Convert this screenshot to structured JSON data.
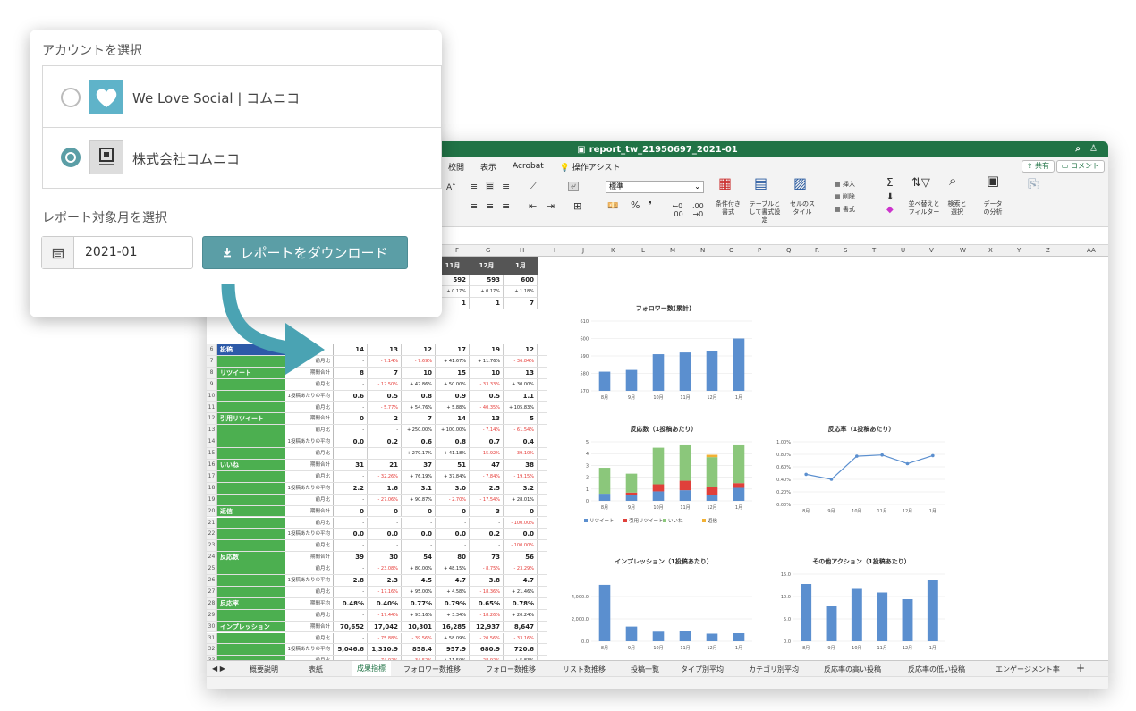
{
  "popup": {
    "account_heading": "アカウントを選択",
    "accounts": [
      {
        "name": "We Love Social | コムニコ",
        "selected": false
      },
      {
        "name": "株式会社コムニコ",
        "selected": true
      }
    ],
    "month_heading": "レポート対象月を選択",
    "month_value": "2021-01",
    "download_label": "レポートをダウンロード",
    "accent": "#5b9ea6"
  },
  "excel": {
    "title": "report_tw_21950697_2021-01",
    "menu": [
      "校閲",
      "表示",
      "Acrobat",
      "操作アシスト"
    ],
    "share": "共有",
    "comment": "コメント",
    "number_format": "標準",
    "ribbon": {
      "cond_format": "条件付き書式",
      "table_format": "テーブルとして書式設定",
      "cell_style": "セルのスタイル",
      "insert": "挿入",
      "delete": "削除",
      "format": "書式",
      "sort_filter": "並べ替えとフィルター",
      "find_select": "検索と選択",
      "data_analysis": "データの分析"
    },
    "columns": [
      "F",
      "G",
      "H",
      "I",
      "J",
      "K",
      "L",
      "M",
      "N",
      "O",
      "P",
      "Q",
      "R",
      "S",
      "T",
      "U",
      "V",
      "W",
      "X",
      "Y",
      "Z",
      "AA"
    ],
    "month_headers": [
      "11月",
      "12月",
      "1月"
    ],
    "sheet_tabs": [
      "概要説明",
      "表紙",
      "成果指標",
      "フォロワー数推移",
      "フォロー数推移",
      "リスト数推移",
      "投稿一覧",
      "タイプ別平均",
      "カテゴリ別平均",
      "反応率の高い投稿",
      "反応率の低い投稿",
      "エンゲージメント率"
    ],
    "active_tab": "成果指標",
    "top_rows": [
      {
        "vals": [
          "592",
          "593",
          "600"
        ]
      },
      {
        "vals": [
          "+ 0.17%",
          "+ 0.17%",
          "+ 1.18%"
        ]
      },
      {
        "vals": [
          "1",
          "1",
          "7"
        ]
      }
    ],
    "rows": [
      {
        "n": "6",
        "label": "投稿",
        "sub": "",
        "v": [
          "14",
          "13",
          "12",
          "17",
          "19",
          "12"
        ],
        "b": true
      },
      {
        "n": "7",
        "sub": "前月比",
        "v": [
          "-",
          "- 7.14%",
          "- 7.69%",
          "+ 41.67%",
          "+ 11.76%",
          "- 36.84%"
        ]
      },
      {
        "n": "8",
        "label": "リツイート",
        "sub": "期間合計",
        "v": [
          "8",
          "7",
          "10",
          "15",
          "10",
          "13"
        ],
        "b": true
      },
      {
        "n": "9",
        "sub": "前月比",
        "v": [
          "-",
          "- 12.50%",
          "+ 42.86%",
          "+ 50.00%",
          "- 33.33%",
          "+ 30.00%"
        ]
      },
      {
        "n": "10",
        "sub": "1投稿あたりの平均",
        "v": [
          "0.6",
          "0.5",
          "0.8",
          "0.9",
          "0.5",
          "1.1"
        ],
        "b": true
      },
      {
        "n": "11",
        "sub": "前月比",
        "v": [
          "-",
          "- 5.77%",
          "+ 54.76%",
          "+ 5.88%",
          "- 40.35%",
          "+ 105.83%"
        ]
      },
      {
        "n": "12",
        "label": "引用リツイート",
        "sub": "期間合計",
        "v": [
          "0",
          "2",
          "7",
          "14",
          "13",
          "5"
        ],
        "b": true
      },
      {
        "n": "13",
        "sub": "前月比",
        "v": [
          "-",
          "-",
          "+ 250.00%",
          "+ 100.00%",
          "- 7.14%",
          "- 61.54%"
        ]
      },
      {
        "n": "14",
        "sub": "1投稿あたりの平均",
        "v": [
          "0.0",
          "0.2",
          "0.6",
          "0.8",
          "0.7",
          "0.4"
        ],
        "b": true
      },
      {
        "n": "15",
        "sub": "前月比",
        "v": [
          "-",
          "-",
          "+ 279.17%",
          "+ 41.18%",
          "- 15.92%",
          "- 39.10%"
        ]
      },
      {
        "n": "16",
        "label": "いいね",
        "sub": "期間合計",
        "v": [
          "31",
          "21",
          "37",
          "51",
          "47",
          "38"
        ],
        "b": true
      },
      {
        "n": "17",
        "sub": "前月比",
        "v": [
          "-",
          "- 32.26%",
          "+ 76.19%",
          "+ 37.84%",
          "- 7.84%",
          "- 19.15%"
        ]
      },
      {
        "n": "18",
        "sub": "1投稿あたりの平均",
        "v": [
          "2.2",
          "1.6",
          "3.1",
          "3.0",
          "2.5",
          "3.2"
        ],
        "b": true
      },
      {
        "n": "19",
        "sub": "前月比",
        "v": [
          "-",
          "- 27.06%",
          "+ 90.87%",
          "- 2.70%",
          "- 17.54%",
          "+ 28.01%"
        ]
      },
      {
        "n": "20",
        "label": "返信",
        "sub": "期間合計",
        "v": [
          "0",
          "0",
          "0",
          "0",
          "3",
          "0"
        ],
        "b": true
      },
      {
        "n": "21",
        "sub": "前月比",
        "v": [
          "-",
          "-",
          "-",
          "-",
          "-",
          "- 100.00%"
        ]
      },
      {
        "n": "22",
        "sub": "1投稿あたりの平均",
        "v": [
          "0.0",
          "0.0",
          "0.0",
          "0.0",
          "0.2",
          "0.0"
        ],
        "b": true
      },
      {
        "n": "23",
        "sub": "前月比",
        "v": [
          "-",
          "-",
          "-",
          "-",
          "-",
          "- 100.00%"
        ]
      },
      {
        "n": "24",
        "label": "反応数",
        "sub": "期間合計",
        "v": [
          "39",
          "30",
          "54",
          "80",
          "73",
          "56"
        ],
        "b": true
      },
      {
        "n": "25",
        "sub": "前月比",
        "v": [
          "-",
          "- 23.08%",
          "+ 80.00%",
          "+ 48.15%",
          "- 8.75%",
          "- 23.29%"
        ]
      },
      {
        "n": "26",
        "sub": "1投稿あたりの平均",
        "v": [
          "2.8",
          "2.3",
          "4.5",
          "4.7",
          "3.8",
          "4.7"
        ],
        "b": true
      },
      {
        "n": "27",
        "sub": "前月比",
        "v": [
          "-",
          "- 17.16%",
          "+ 95.00%",
          "+ 4.58%",
          "- 18.36%",
          "+ 21.46%"
        ]
      },
      {
        "n": "28",
        "label": "反応率",
        "sub": "期間平均",
        "v": [
          "0.48%",
          "0.40%",
          "0.77%",
          "0.79%",
          "0.65%",
          "0.78%"
        ],
        "b": true
      },
      {
        "n": "29",
        "sub": "前月比",
        "v": [
          "-",
          "- 17.44%",
          "+ 93.16%",
          "+ 3.34%",
          "- 18.26%",
          "+ 20.24%"
        ]
      },
      {
        "n": "30",
        "label": "インプレッション",
        "sub": "期間合計",
        "v": [
          "70,652",
          "17,042",
          "10,301",
          "16,285",
          "12,937",
          "8,647"
        ],
        "b": true
      },
      {
        "n": "31",
        "sub": "前月比",
        "v": [
          "-",
          "- 75.88%",
          "- 39.56%",
          "+ 58.09%",
          "- 20.56%",
          "- 33.16%"
        ]
      },
      {
        "n": "32",
        "sub": "1投稿あたりの平均",
        "v": [
          "5,046.6",
          "1,310.9",
          "858.4",
          "957.9",
          "680.9",
          "720.6"
        ],
        "b": true
      },
      {
        "n": "33",
        "sub": "前月比",
        "v": [
          "-",
          "- 74.02%",
          "- 34.52%",
          "+ 11.59%",
          "- 28.92%",
          "+ 5.83%"
        ]
      },
      {
        "n": "34",
        "label": "その他アクション",
        "sub": "期間合計",
        "v": [
          "179",
          "102",
          "140",
          "185",
          "179",
          "165"
        ],
        "b": true
      },
      {
        "n": "35",
        "sub": "前月比",
        "v": [
          "-",
          "- 43.02%",
          "+ 37.25%",
          "+ 32.14%",
          "- 3.24%",
          "- 7.82%"
        ]
      }
    ]
  },
  "chart_data": [
    {
      "type": "bar",
      "title": "フォロワー数(累計)",
      "categories": [
        "8月",
        "9月",
        "10月",
        "11月",
        "12月",
        "1月"
      ],
      "values": [
        581,
        582,
        591,
        592,
        593,
        600
      ],
      "ylim": [
        570,
        610
      ],
      "yticks": [
        "570",
        "580",
        "590",
        "600",
        "610"
      ]
    },
    {
      "type": "bar",
      "title": "反応数（1投稿あたり）",
      "categories": [
        "8月",
        "9月",
        "10月",
        "11月",
        "12月",
        "1月"
      ],
      "ylim": [
        0,
        5
      ],
      "yticks": [
        "0",
        "1",
        "2",
        "3",
        "4",
        "5"
      ],
      "series": [
        {
          "name": "リツイート",
          "values": [
            0.6,
            0.5,
            0.8,
            0.9,
            0.5,
            1.1
          ],
          "color": "#5b8fcf"
        },
        {
          "name": "引用リツイート",
          "values": [
            0.0,
            0.2,
            0.6,
            0.8,
            0.7,
            0.4
          ],
          "color": "#e0403a"
        },
        {
          "name": "いいね",
          "values": [
            2.2,
            1.6,
            3.1,
            3.0,
            2.5,
            3.2
          ],
          "color": "#8bc77b"
        },
        {
          "name": "返信",
          "values": [
            0.0,
            0.0,
            0.0,
            0.0,
            0.2,
            0.0
          ],
          "color": "#f2b134"
        }
      ]
    },
    {
      "type": "line",
      "title": "反応率（1投稿あたり）",
      "categories": [
        "8月",
        "9月",
        "10月",
        "11月",
        "12月",
        "1月"
      ],
      "values": [
        0.48,
        0.4,
        0.77,
        0.79,
        0.65,
        0.78
      ],
      "ylim": [
        0,
        1.0
      ],
      "yticks": [
        "0.00%",
        "0.20%",
        "0.40%",
        "0.60%",
        "0.80%",
        "1.00%"
      ]
    },
    {
      "type": "bar",
      "title": "インプレッション（1投稿あたり）",
      "categories": [
        "8月",
        "9月",
        "10月",
        "11月",
        "12月",
        "1月"
      ],
      "values": [
        5046.6,
        1310.9,
        858.4,
        957.9,
        680.9,
        720.6
      ],
      "ylim": [
        0,
        6000
      ],
      "yticks": [
        "0.0",
        "2,000.0",
        "4,000.0"
      ]
    },
    {
      "type": "bar",
      "title": "その他アクション（1投稿あたり）",
      "categories": [
        "8月",
        "9月",
        "10月",
        "11月",
        "12月",
        "1月"
      ],
      "values": [
        12.8,
        7.8,
        11.7,
        10.9,
        9.4,
        13.8
      ],
      "ylim": [
        0,
        15
      ],
      "yticks": [
        "0.0",
        "5.0",
        "10.0",
        "15.0"
      ]
    }
  ]
}
